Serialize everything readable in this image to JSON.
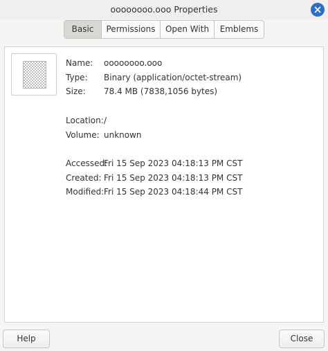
{
  "window": {
    "title": "oooooooo.ooo Properties",
    "close_icon": "window-close-icon",
    "accent": "#2d6fc4"
  },
  "tabs": [
    {
      "label": "Basic",
      "active": true
    },
    {
      "label": "Permissions",
      "active": false
    },
    {
      "label": "Open With",
      "active": false
    },
    {
      "label": "Emblems",
      "active": false
    }
  ],
  "file_icon": "file-thumbnail-icon",
  "info": {
    "name_label": "Name:",
    "name_value": "oooooooo.ooo",
    "type_label": "Type:",
    "type_value": "Binary (application/octet-stream)",
    "size_label": "Size:",
    "size_value": "78.4 MB (7838,1056 bytes)",
    "location_label": "Location:",
    "location_value": "/",
    "volume_label": "Volume:",
    "volume_value": "unknown",
    "accessed_label": "Accessed:",
    "accessed_value": "Fri 15 Sep 2023 04:18:13 PM CST",
    "created_label": "Created:",
    "created_value": "Fri 15 Sep 2023 04:18:13 PM CST",
    "modified_label": "Modified:",
    "modified_value": "Fri 15 Sep 2023 04:18:44 PM CST"
  },
  "buttons": {
    "help": "Help",
    "close": "Close"
  }
}
